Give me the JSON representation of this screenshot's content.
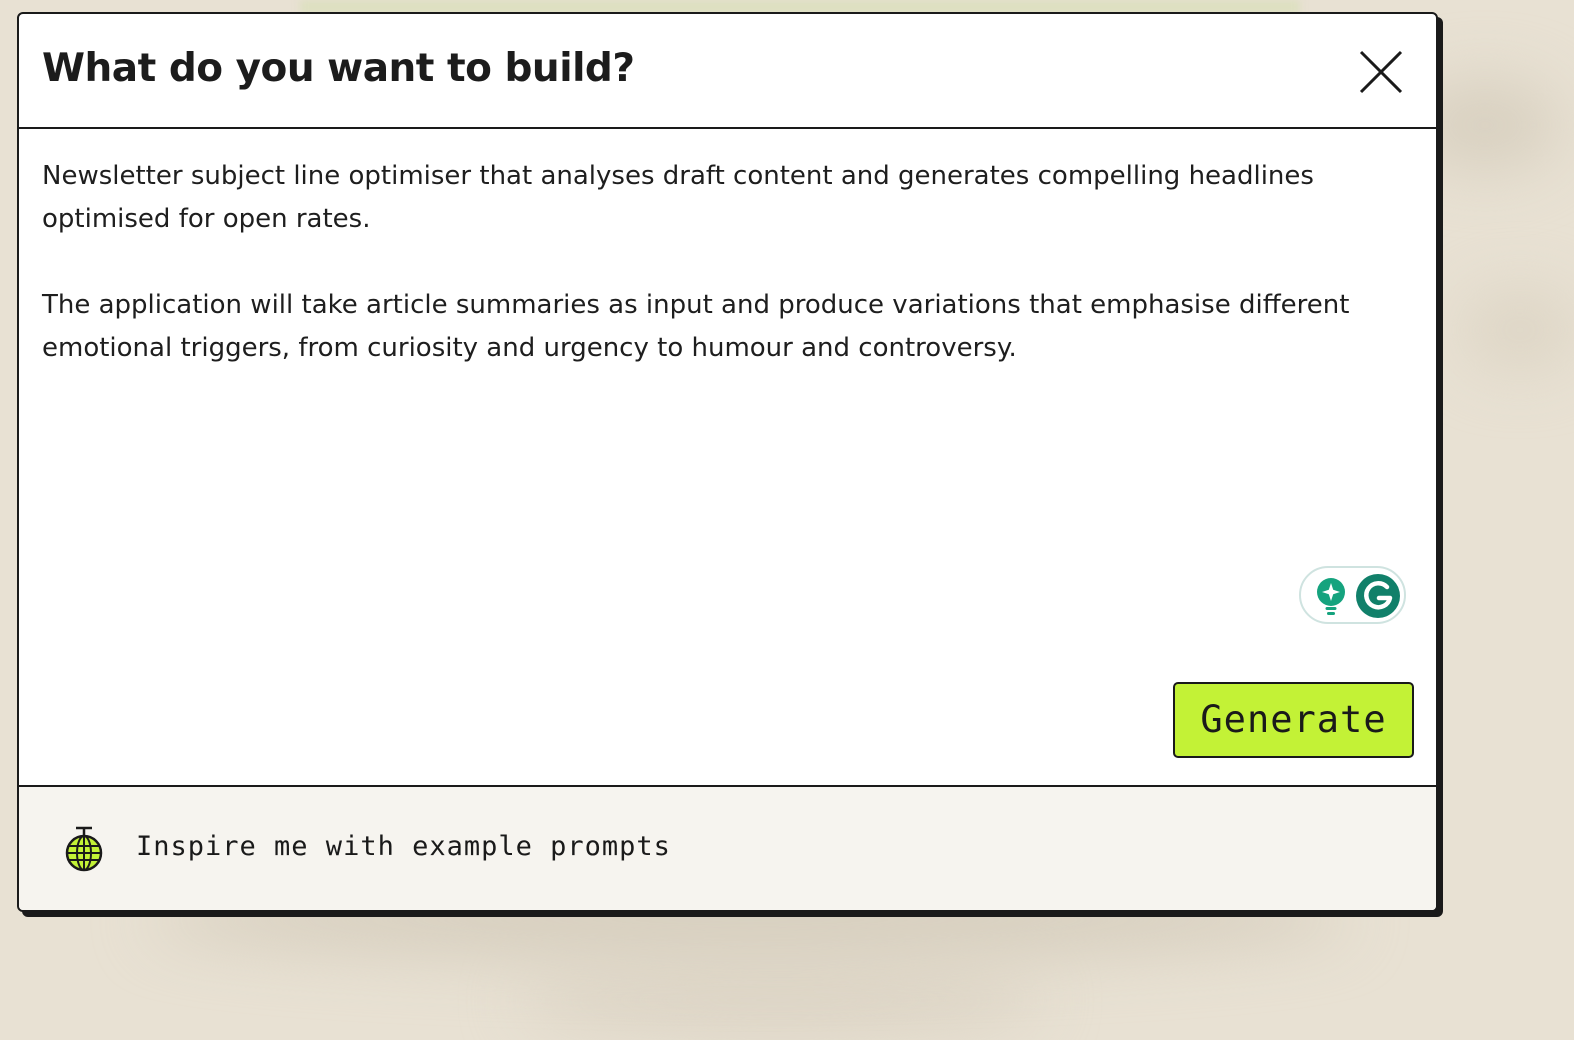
{
  "dialog": {
    "title": "What do you want to build?",
    "close_icon": "close-icon"
  },
  "prompt": {
    "value": "Newsletter subject line optimiser that analyses draft content and generates compelling headlines optimised for open rates.\n\nThe application will take article summaries as input and produce variations that emphasise different emotional triggers, from curiosity and urgency to humour and controversy."
  },
  "grammarly": {
    "icons": [
      "lightbulb-sparkle-icon",
      "grammarly-g-icon"
    ],
    "color": "#15a37e"
  },
  "actions": {
    "generate_label": "Generate"
  },
  "footer": {
    "inspire_label": "Inspire me with example prompts",
    "icon": "disco-ball-icon"
  },
  "colors": {
    "accent": "#c3f236",
    "border": "#1a1a1a",
    "footer_bg": "#f6f4ef",
    "background": "#e8e1d3"
  }
}
